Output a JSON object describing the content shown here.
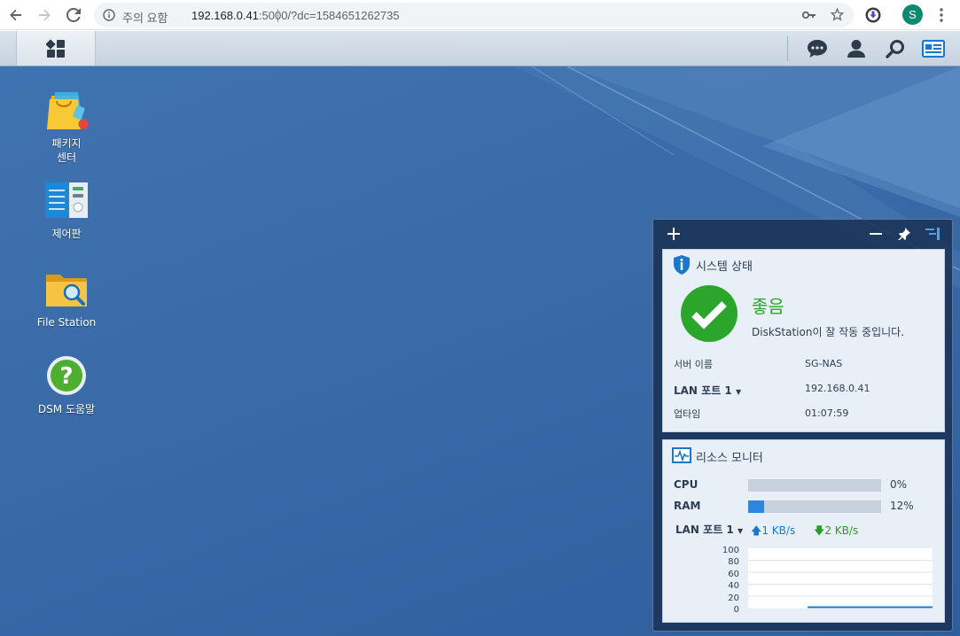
{
  "browser": {
    "security_label": "주의 요함",
    "url_host": "192.168.0.41",
    "url_rest": ":5000/?dc=1584651262735",
    "profile_initial": "S"
  },
  "desktop": {
    "icons": [
      {
        "label_line1": "패키지",
        "label_line2": "센터"
      },
      {
        "label_line1": "제어판",
        "label_line2": ""
      },
      {
        "label_line1": "File Station",
        "label_line2": ""
      },
      {
        "label_line1": "DSM 도움말",
        "label_line2": ""
      }
    ]
  },
  "system_health": {
    "title": "시스템 상태",
    "status": "좋음",
    "message": "DiskStation이 잘 작동 중입니다.",
    "rows": [
      {
        "label": "서버 이름",
        "value": "SG-NAS"
      },
      {
        "label": "LAN 포트 1",
        "value": "192.168.0.41"
      },
      {
        "label": "업타임",
        "value": "01:07:59"
      }
    ]
  },
  "resource_monitor": {
    "title": "리소스 모니터",
    "cpu_label": "CPU",
    "cpu_value": "0%",
    "cpu_fraction": 0.0,
    "ram_label": "RAM",
    "ram_value": "12%",
    "ram_fraction": 0.12,
    "lan_label": "LAN 포트 1",
    "upload": "1 KB/s",
    "download": "2 KB/s",
    "chart_ticks": [
      "100",
      "80",
      "60",
      "40",
      "20",
      "0"
    ]
  },
  "colors": {
    "status_green": "#2ba52b",
    "accent_blue": "#2d86dc",
    "upload_blue": "#1a78c8",
    "download_green": "#2a9a2a"
  }
}
